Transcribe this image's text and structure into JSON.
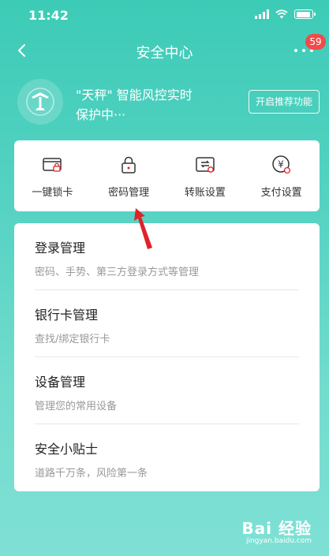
{
  "status_bar": {
    "time": "11:42"
  },
  "nav": {
    "title": "安全中心",
    "badge": "59"
  },
  "banner": {
    "line1": "\"天秤\" 智能风控实时",
    "line2": "保护中···",
    "button": "开启推荐功能"
  },
  "tools": [
    {
      "label": "一键锁卡",
      "icon": "card-lock-icon"
    },
    {
      "label": "密码管理",
      "icon": "padlock-icon"
    },
    {
      "label": "转账设置",
      "icon": "transfer-icon"
    },
    {
      "label": "支付设置",
      "icon": "yen-payment-icon"
    }
  ],
  "menu": [
    {
      "title": "登录管理",
      "sub": "密码、手势、第三方登录方式等管理"
    },
    {
      "title": "银行卡管理",
      "sub": "查找/绑定银行卡"
    },
    {
      "title": "设备管理",
      "sub": "管理您的常用设备"
    },
    {
      "title": "安全小贴士",
      "sub": "道路千万条，风险第一条"
    }
  ],
  "watermark": {
    "logo": "Bai 经验",
    "url": "jingyan.baidu.com"
  },
  "colors": {
    "accent": "#3ccbb6",
    "badge": "#f24a4a",
    "arrow": "#e0222b"
  }
}
